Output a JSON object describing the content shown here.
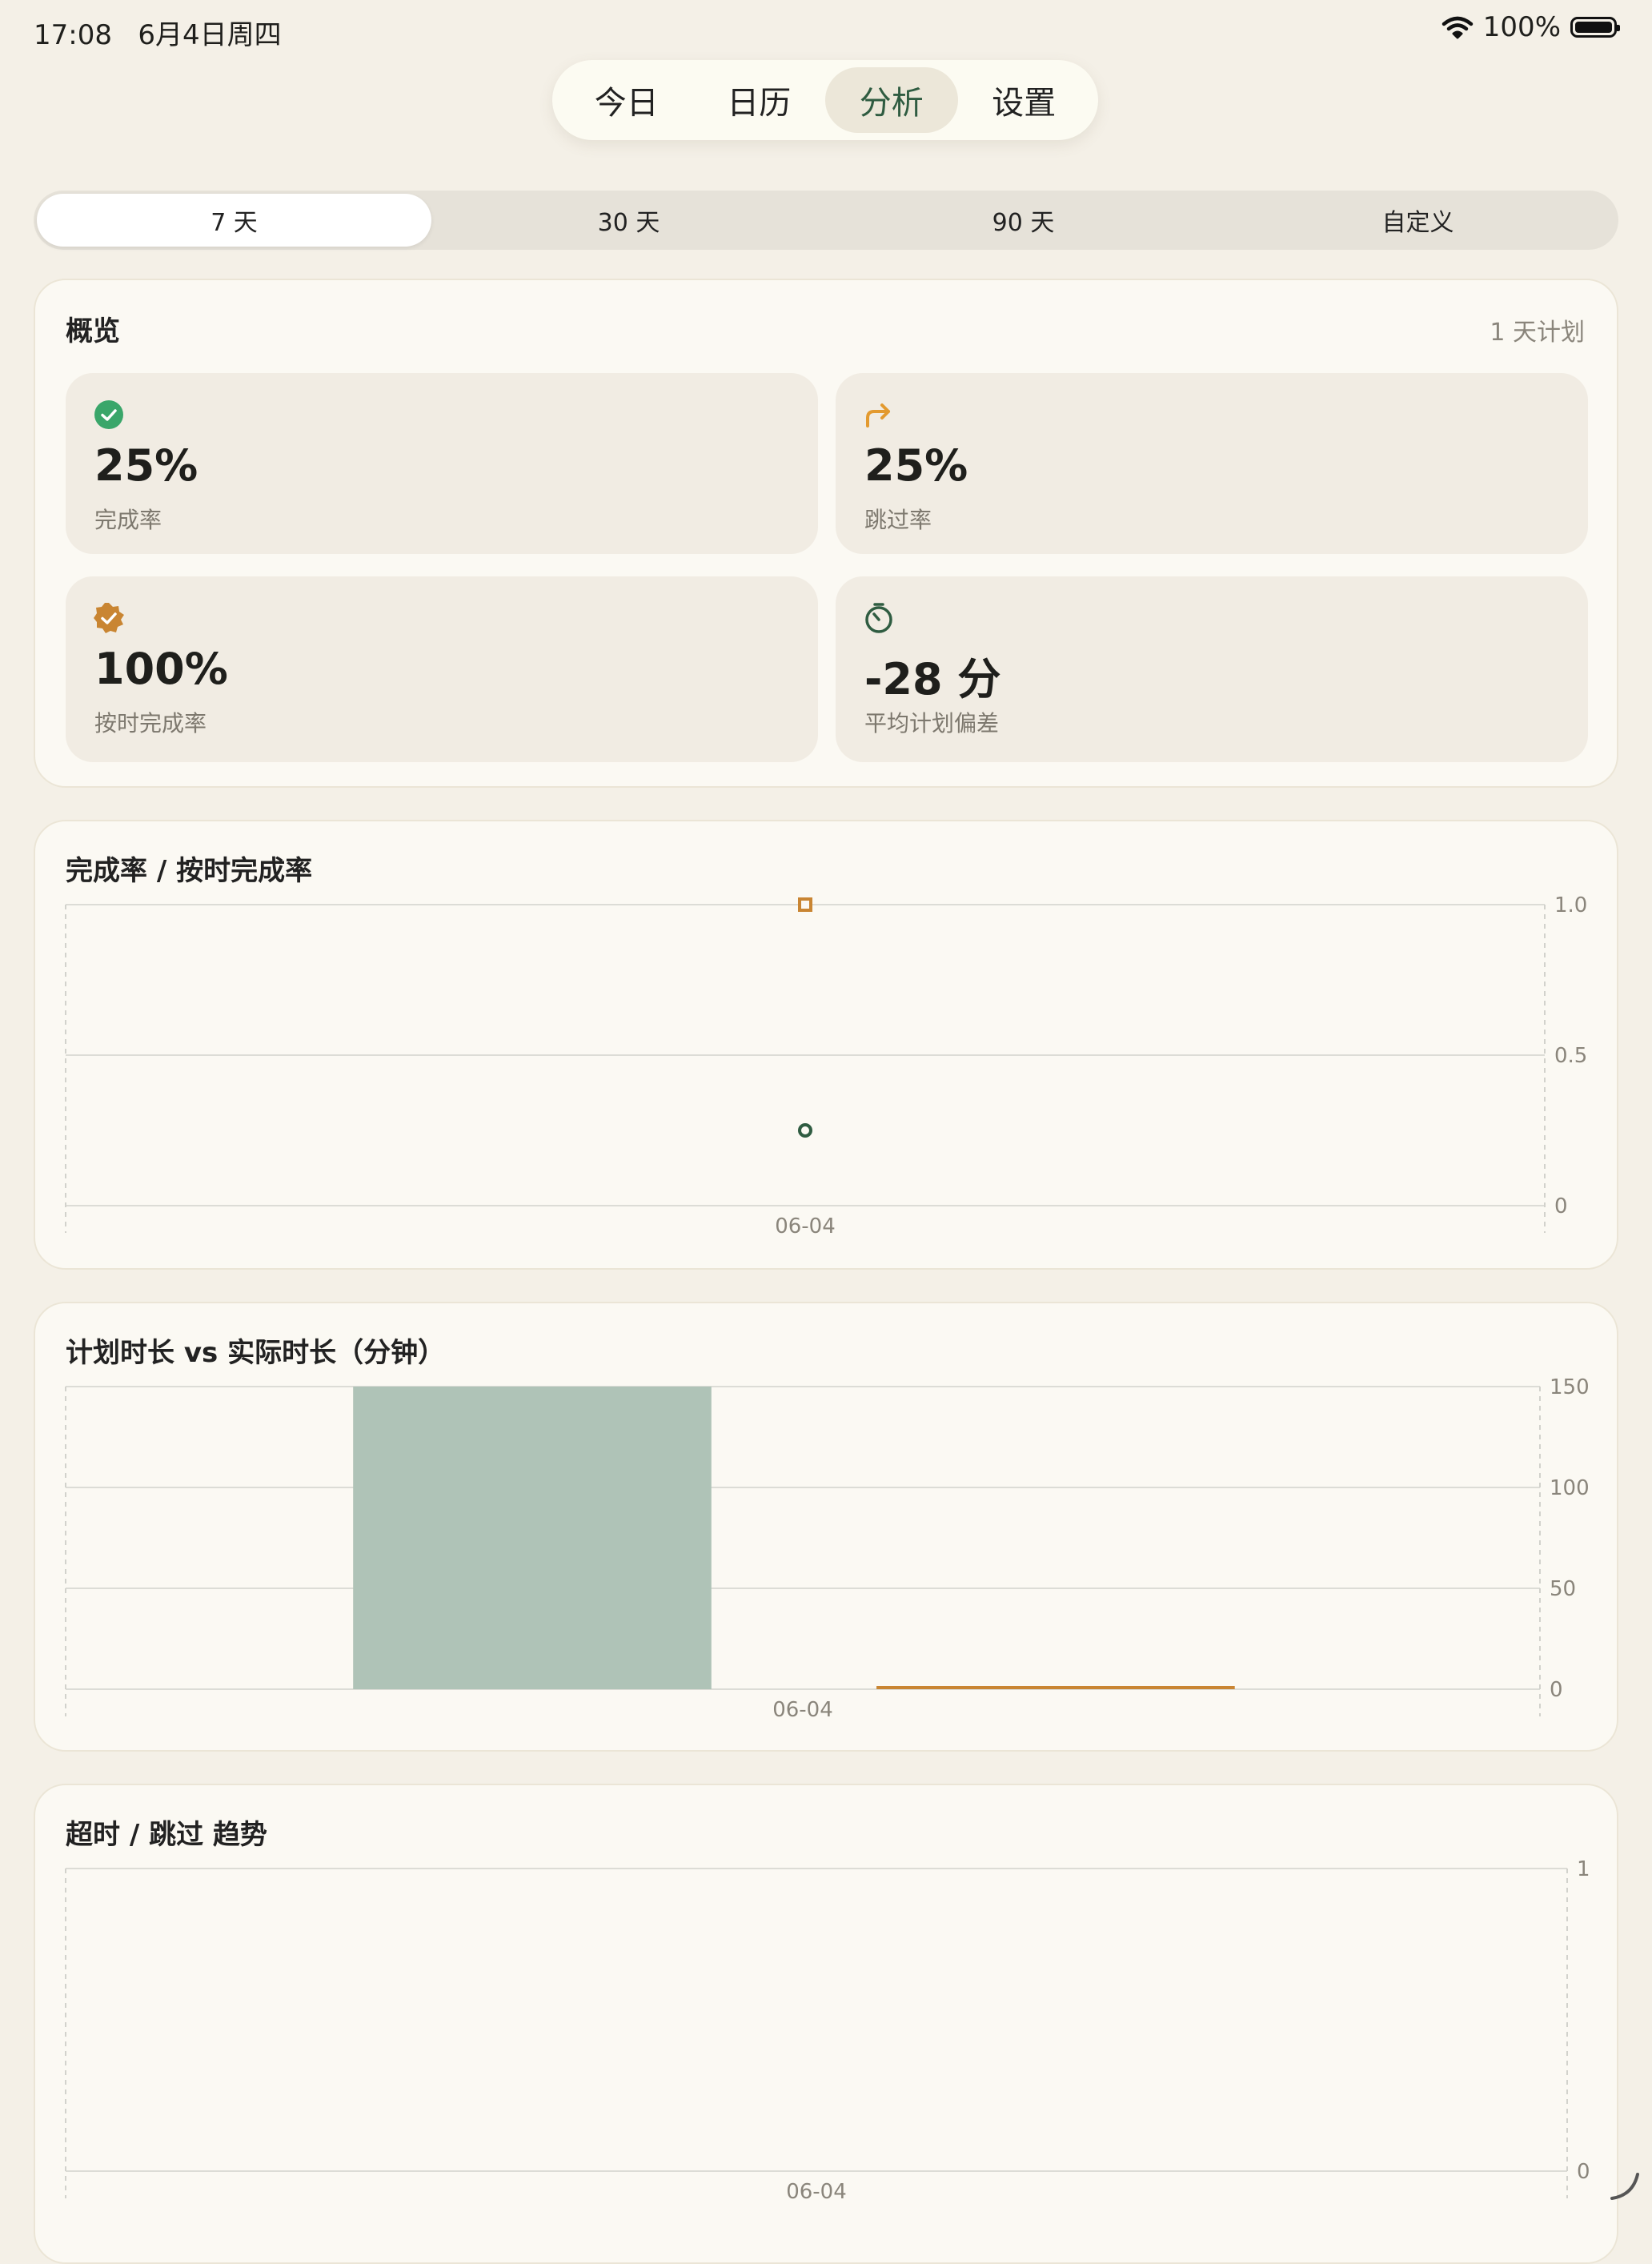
{
  "status_bar": {
    "time": "17:08",
    "date": "6月4日周四",
    "battery": "100%",
    "icons": [
      "wifi-icon",
      "battery-icon"
    ]
  },
  "nav": {
    "tabs": [
      "今日",
      "日历",
      "分析",
      "设置"
    ],
    "active": "分析"
  },
  "range": {
    "options": [
      "7 天",
      "30 天",
      "90 天",
      "自定义"
    ],
    "active": "7 天"
  },
  "overview": {
    "title": "概览",
    "subtitle": "1 天计划",
    "stats": [
      {
        "value": "25%",
        "label": "完成率",
        "icon": "check-circle-icon",
        "color": "#3aa66a"
      },
      {
        "value": "25%",
        "label": "跳过率",
        "icon": "redo-arrow-icon",
        "color": "#e39a2f"
      },
      {
        "value": "100%",
        "label": "按时完成率",
        "icon": "verified-badge-icon",
        "color": "#c98532"
      },
      {
        "value": "-28 分",
        "label": "平均计划偏差",
        "icon": "timer-icon",
        "color": "#2f5c41"
      }
    ]
  },
  "colors": {
    "green": "#2f5c41",
    "orange": "#c98532",
    "bar_green": "#afc3b7",
    "background": "#f4f0e7"
  },
  "chart_data": [
    {
      "type": "scatter",
      "title": "完成率 / 按时完成率",
      "categories": [
        "06-04"
      ],
      "yticks": [
        "1.0",
        "0.5",
        "0"
      ],
      "ylim": [
        0,
        1
      ],
      "series": [
        {
          "values": [
            0.25
          ],
          "marker": "circle",
          "color": "#2f5c41"
        },
        {
          "values": [
            1.0
          ],
          "marker": "square",
          "color": "#c98532"
        }
      ]
    },
    {
      "type": "bar",
      "title": "计划时长 vs 实际时长（分钟）",
      "categories": [
        "06-04"
      ],
      "yticks": [
        "150",
        "100",
        "50",
        "0"
      ],
      "ylim": [
        0,
        150
      ],
      "series": [
        {
          "values": [
            150
          ],
          "color": "#afc3b7"
        },
        {
          "values": [
            0
          ],
          "color": "#c98532"
        }
      ]
    },
    {
      "type": "line",
      "title": "超时 / 跳过 趋势",
      "categories": [
        "06-04"
      ],
      "yticks": [
        "1",
        "0"
      ],
      "ylim": [
        0,
        1
      ],
      "series": []
    }
  ]
}
